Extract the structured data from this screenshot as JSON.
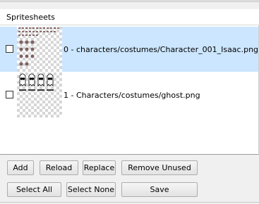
{
  "panel": {
    "title": "Spritesheets"
  },
  "spritesheets": [
    {
      "label": "0 - characters/costumes/Character_001_Isaac.png",
      "checked": false,
      "selected": true,
      "thumbnail_icon": "isaac-sprite-thumbnail"
    },
    {
      "label": "1 - Characters/costumes/ghost.png",
      "checked": false,
      "selected": false,
      "thumbnail_icon": "ghost-sprite-thumbnail"
    }
  ],
  "buttons": {
    "add": "Add",
    "reload": "Reload",
    "replace": "Replace",
    "remove_unused": "Remove Unused",
    "select_all": "Select All",
    "select_none": "Select None",
    "save": "Save"
  },
  "colors": {
    "selection": "#cce6ff",
    "background": "#f0f0f0",
    "checker": "#d6d6d6"
  }
}
